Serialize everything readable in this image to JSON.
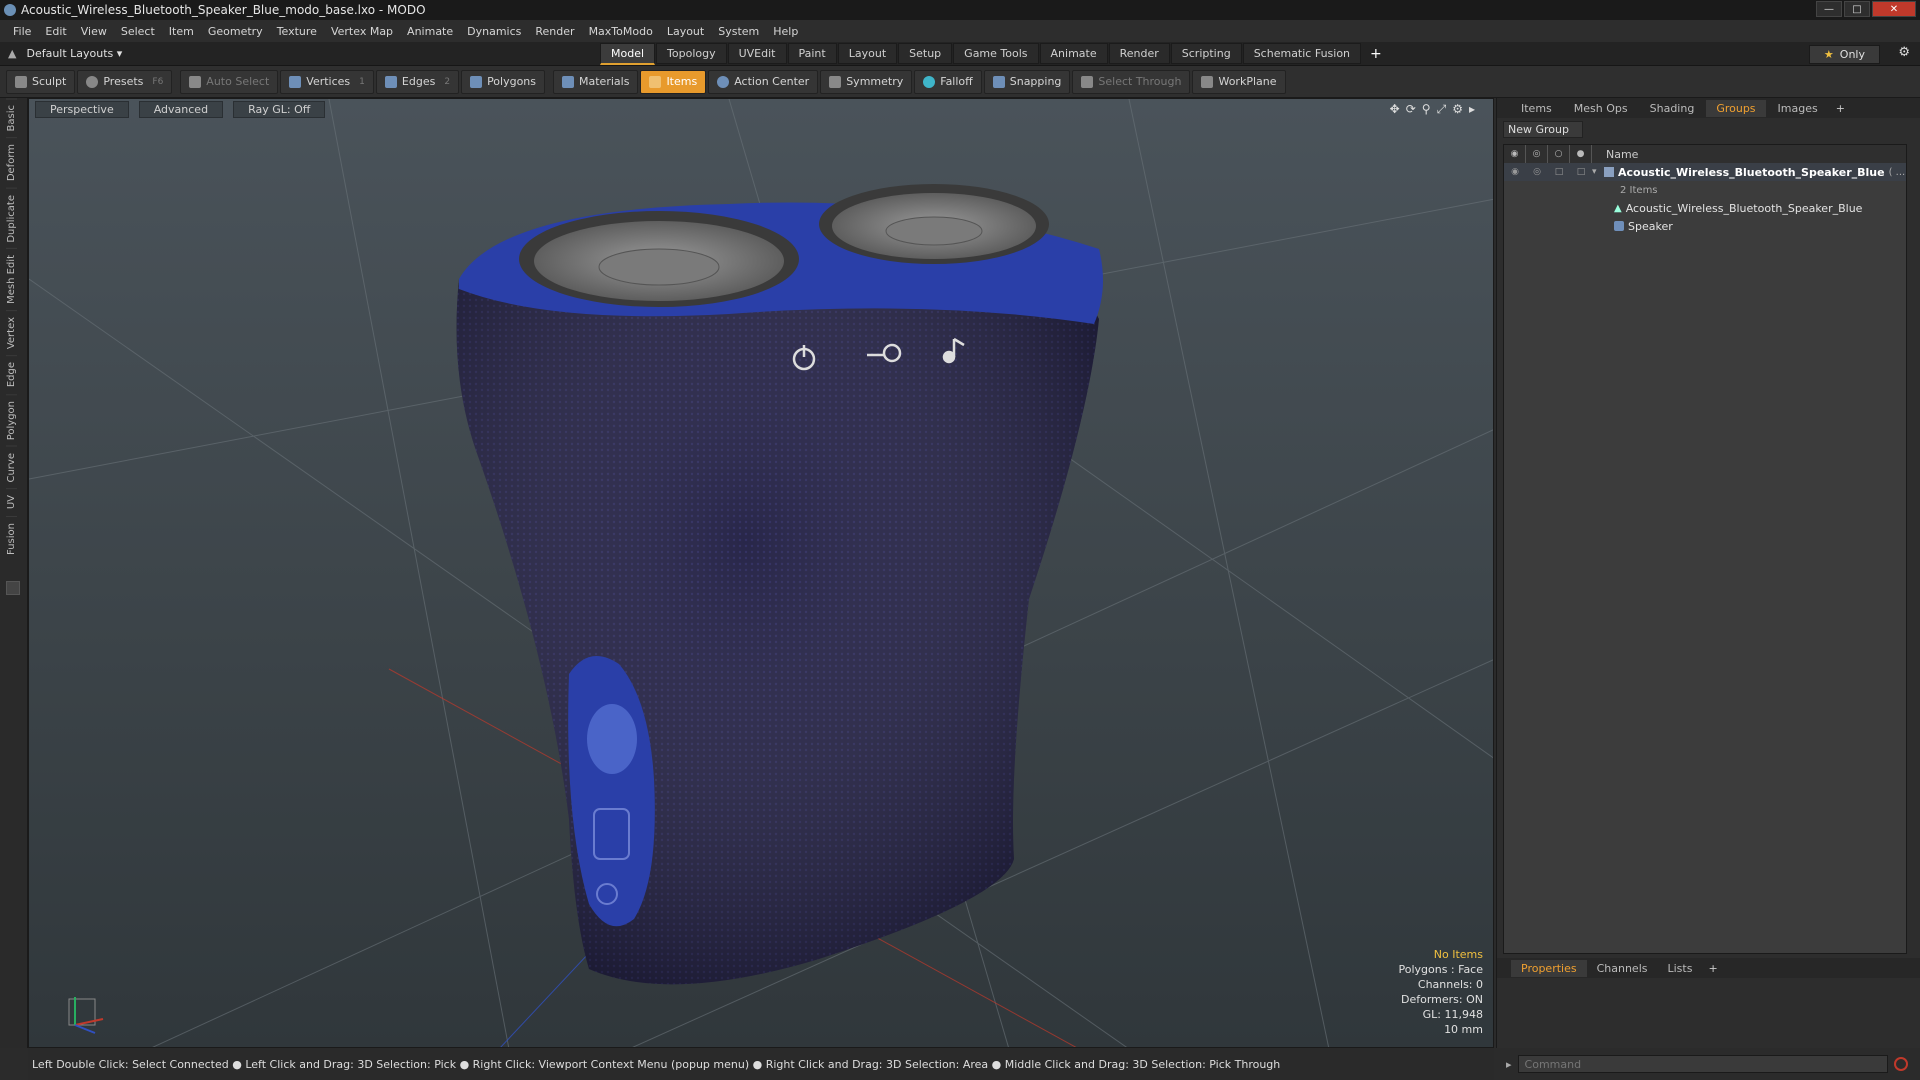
{
  "window": {
    "title": "Acoustic_Wireless_Bluetooth_Speaker_Blue_modo_base.lxo - MODO"
  },
  "menu": [
    "File",
    "Edit",
    "View",
    "Select",
    "Item",
    "Geometry",
    "Texture",
    "Vertex Map",
    "Animate",
    "Dynamics",
    "Render",
    "MaxToModo",
    "Layout",
    "System",
    "Help"
  ],
  "layouts": {
    "label": "Default Layouts ▾"
  },
  "mode_tabs": [
    "Model",
    "Topology",
    "UVEdit",
    "Paint",
    "Layout",
    "Setup",
    "Game Tools",
    "Animate",
    "Render",
    "Scripting",
    "Schematic Fusion"
  ],
  "mode_active": "Model",
  "only_label": "Only",
  "toolbar": {
    "sculpt": "Sculpt",
    "presets": "Presets",
    "presets_key": "F6",
    "auto_select": "Auto Select",
    "vertices": "Vertices",
    "vertices_key": "1",
    "edges": "Edges",
    "edges_key": "2",
    "polygons": "Polygons",
    "materials": "Materials",
    "items": "Items",
    "action_center": "Action Center",
    "symmetry": "Symmetry",
    "falloff": "Falloff",
    "snapping": "Snapping",
    "select_through": "Select Through",
    "workplane": "WorkPlane"
  },
  "left_tabs": [
    "Basic",
    "Deform",
    "Duplicate",
    "Mesh Edit",
    "Vertex",
    "Edge",
    "Polygon",
    "Curve",
    "UV",
    "Fusion"
  ],
  "viewport": {
    "view": "Perspective",
    "shading": "Advanced",
    "raygl": "Ray GL: Off",
    "info": {
      "items": "No Items",
      "polygons": "Polygons : Face",
      "channels": "Channels: 0",
      "deformers": "Deformers: ON",
      "gl": "GL: 11,948",
      "unit": "10 mm"
    }
  },
  "right_panel": {
    "tabs": [
      "Items",
      "Mesh Ops",
      "Shading",
      "Groups",
      "Images"
    ],
    "active_tab": "Groups",
    "new_group": "New Group",
    "column_name": "Name",
    "group_name": "Acoustic_Wireless_Bluetooth_Speaker_Blue",
    "group_suffix": "( ...",
    "group_count": "2 Items",
    "children": [
      "Acoustic_Wireless_Bluetooth_Speaker_Blue",
      "Speaker"
    ]
  },
  "prop_tabs": [
    "Properties",
    "Channels",
    "Lists"
  ],
  "prop_active": "Properties",
  "status": {
    "hint": "Left Double Click: Select Connected ● Left Click and Drag: 3D Selection: Pick ● Right Click: Viewport Context Menu (popup menu) ● Right Click and Drag: 3D Selection: Area ● Middle Click and Drag: 3D Selection: Pick Through"
  },
  "command": {
    "placeholder": "Command"
  },
  "colors": {
    "accent": "#e89a2c",
    "speaker_fabric": "#1c1a3e",
    "speaker_blue": "#2a3fa8"
  }
}
